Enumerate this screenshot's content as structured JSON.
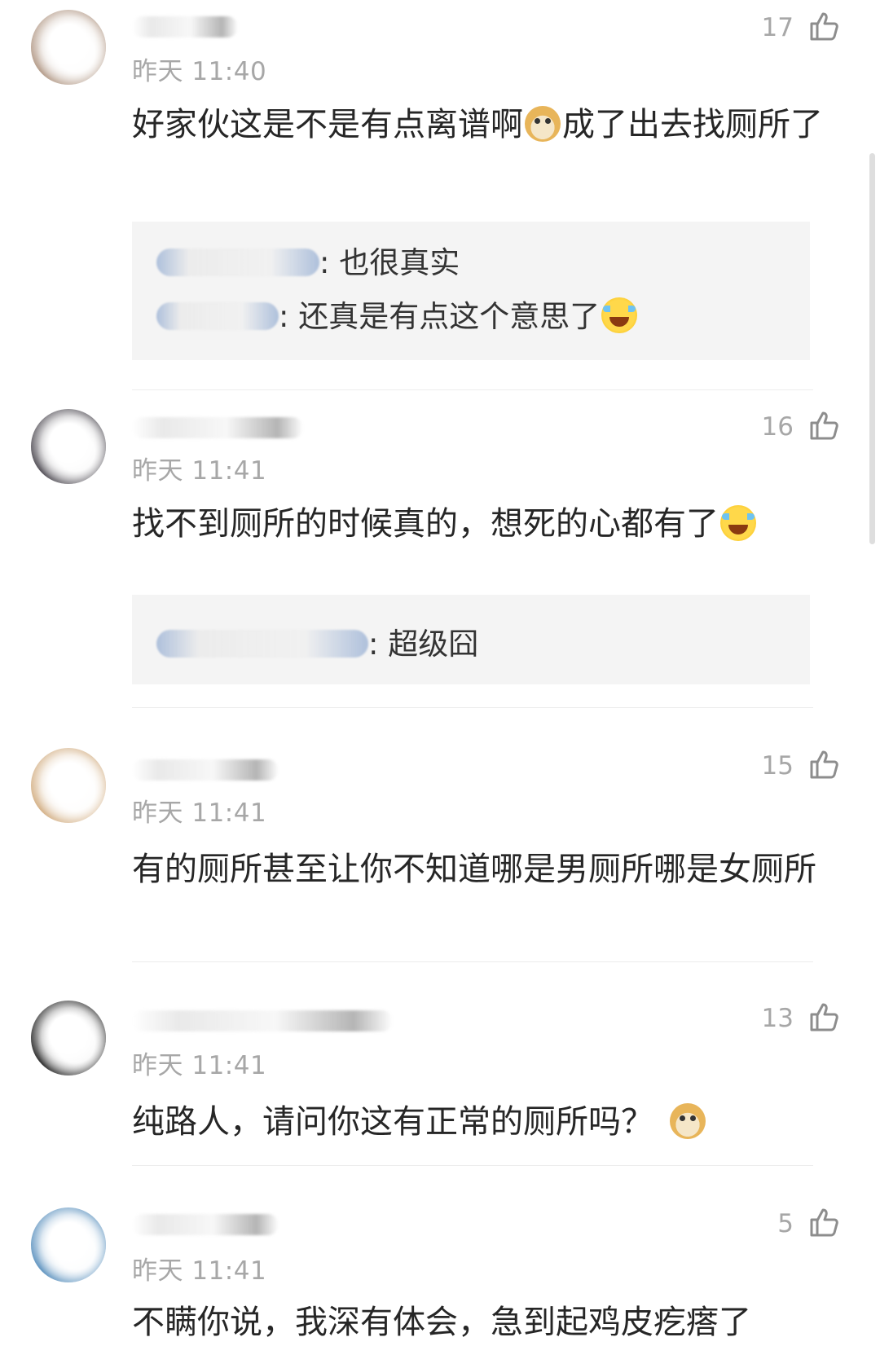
{
  "comments": [
    {
      "time": "昨天 11:40",
      "likes": "17",
      "text_before": "好家伙这是不是有点离谱啊",
      "emoji1": "doge-emoji",
      "text_after": "成了出去找厕所了",
      "replies": [
        {
          "sep": ":",
          "text": " 也很真实"
        },
        {
          "sep": ":",
          "text": " 还真是有点这个意思了"
        }
      ]
    },
    {
      "time": "昨天 11:41",
      "likes": "16",
      "text_before": "找不到厕所的时候真的，想死的心都有了",
      "emoji1": "laugh-cry-emoji",
      "replies": [
        {
          "sep": ":",
          "text": " 超级囧"
        }
      ]
    },
    {
      "time": "昨天 11:41",
      "likes": "15",
      "text_before": "有的厕所甚至让你不知道哪是男厕所哪是女厕所"
    },
    {
      "time": "昨天 11:41",
      "likes": "13",
      "text_before": "纯路人，请问你这有正常的厕所吗？",
      "emoji1": "doge-emoji"
    },
    {
      "time": "昨天 11:41",
      "likes": "5",
      "text_before": "不瞒你说，我深有体会，急到起鸡皮疙瘩了"
    }
  ],
  "icons": {
    "like": "thumbs-up-icon"
  },
  "colors": {
    "secondary_text": "#a7a7a7",
    "reply_background": "#f4f4f4",
    "divider": "#ececec"
  }
}
